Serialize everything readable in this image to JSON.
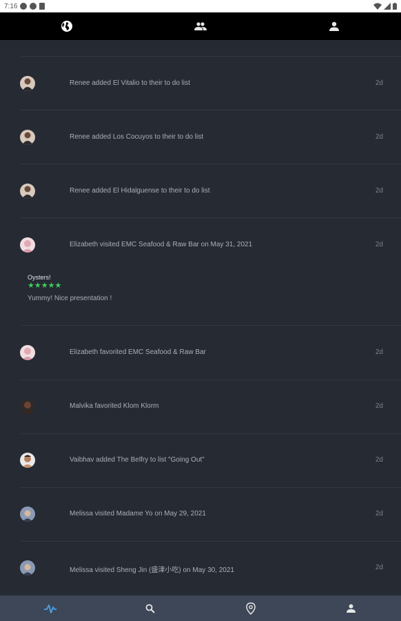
{
  "status_bar": {
    "time": "7:16"
  },
  "top_tabs": [
    {
      "name": "globe-icon"
    },
    {
      "name": "friends-icon"
    },
    {
      "name": "profile-icon"
    }
  ],
  "feed": [
    {
      "text": "Renee added El Vitalio to their to do list",
      "time": "2d",
      "avatar_color": "#8b6d5c"
    },
    {
      "text": "Renee added Los Cocuyos to their to do list",
      "time": "2d",
      "avatar_color": "#8b6d5c"
    },
    {
      "text": "Renee added El Hidalguense to their to do list",
      "time": "2d",
      "avatar_color": "#8b6d5c"
    },
    {
      "text": "Elizabeth  visited EMC Seafood & Raw Bar on May 31, 2021",
      "time": "2d",
      "avatar_color": "#e3b9c2",
      "review": {
        "title": "Oysters!",
        "stars": "★★★★★",
        "body": "Yummy!  Nice presentation !"
      }
    },
    {
      "text": "Elizabeth  favorited EMC Seafood & Raw Bar",
      "time": "2d",
      "avatar_color": "#e3b9c2"
    },
    {
      "text": "Malvika favorited Klom Klorm",
      "time": "2d",
      "avatar_color": "#4a3024"
    },
    {
      "text": "Vaibhav added The Belfry to list \"Going Out\"",
      "time": "2d",
      "avatar_color": "#c58f6b"
    },
    {
      "text": "Melissa visited Madame Yo on May 29, 2021",
      "time": "2d",
      "avatar_color": "#6e7c96"
    },
    {
      "text": "Melissa visited Sheng Jin (盛津小吃) on May 30, 2021",
      "time": "2d",
      "avatar_color": "#6e7c96"
    }
  ],
  "bottom_nav": [
    {
      "name": "activity-icon",
      "active": true
    },
    {
      "name": "search-icon",
      "active": false
    },
    {
      "name": "location-pin-icon",
      "active": false
    },
    {
      "name": "account-icon",
      "active": false
    }
  ],
  "colors": {
    "background": "#262a33",
    "top_bar": "#000000",
    "bottom_bar": "#3e4757",
    "accent": "#4aa3e8",
    "stars": "#3ecf5c"
  }
}
